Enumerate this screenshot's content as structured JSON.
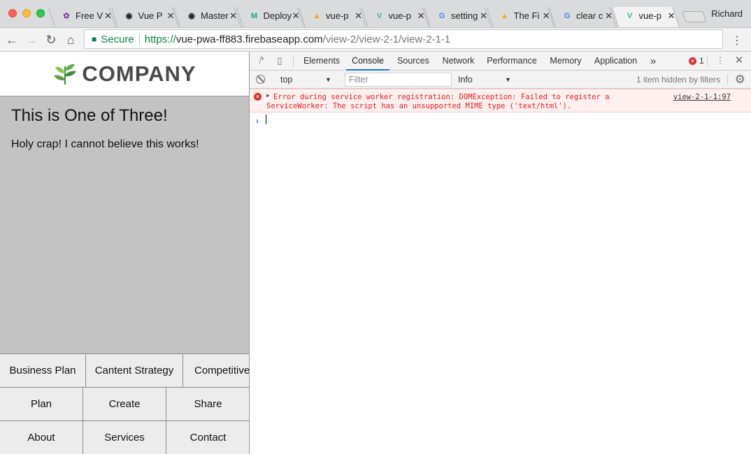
{
  "browser": {
    "profile": "Richard",
    "tabs": [
      {
        "title": "Free V",
        "favicon": "image-favicon",
        "active": false
      },
      {
        "title": "Vue P",
        "favicon": "github-icon",
        "active": false
      },
      {
        "title": "Master",
        "favicon": "github-icon",
        "active": false
      },
      {
        "title": "Deploy",
        "favicon": "netlify-icon",
        "active": false
      },
      {
        "title": "vue-p",
        "favicon": "firebase-icon",
        "active": false
      },
      {
        "title": "vue-p",
        "favicon": "vue-icon",
        "active": false
      },
      {
        "title": "setting",
        "favicon": "google-icon",
        "active": false
      },
      {
        "title": "The Fi",
        "favicon": "firebase-icon",
        "active": false
      },
      {
        "title": "clear c",
        "favicon": "google-icon",
        "active": false
      },
      {
        "title": "vue-p",
        "favicon": "vue-icon",
        "active": true
      }
    ],
    "secure_label": "Secure",
    "url_scheme": "https://",
    "url_host": "vue-pwa-ff883.firebaseapp.com",
    "url_path": "/view-2/view-2-1/view-2-1-1"
  },
  "page": {
    "logo_text": "COMPANY",
    "title": "This is One of Three!",
    "body": "Holy crap! I cannot believe this works!",
    "nav_row1": [
      "Business Plan",
      "Cantent Strategy",
      "Competitive"
    ],
    "nav_row2": [
      "Plan",
      "Create",
      "Share"
    ],
    "nav_row3": [
      "About",
      "Services",
      "Contact"
    ]
  },
  "devtools": {
    "tabs": [
      "Elements",
      "Console",
      "Sources",
      "Network",
      "Performance",
      "Memory",
      "Application"
    ],
    "active_tab": "Console",
    "more": "»",
    "error_count": "1",
    "context": "top",
    "filter_placeholder": "Filter",
    "level": "Info",
    "hidden_note": "1 item hidden by filters",
    "error": {
      "line1": "Error during service worker registration: DOMException: Failed to register a",
      "line2": "ServiceWorker: The script has an unsupported MIME type ('text/html').",
      "source": "view-2-1-1:97"
    }
  }
}
